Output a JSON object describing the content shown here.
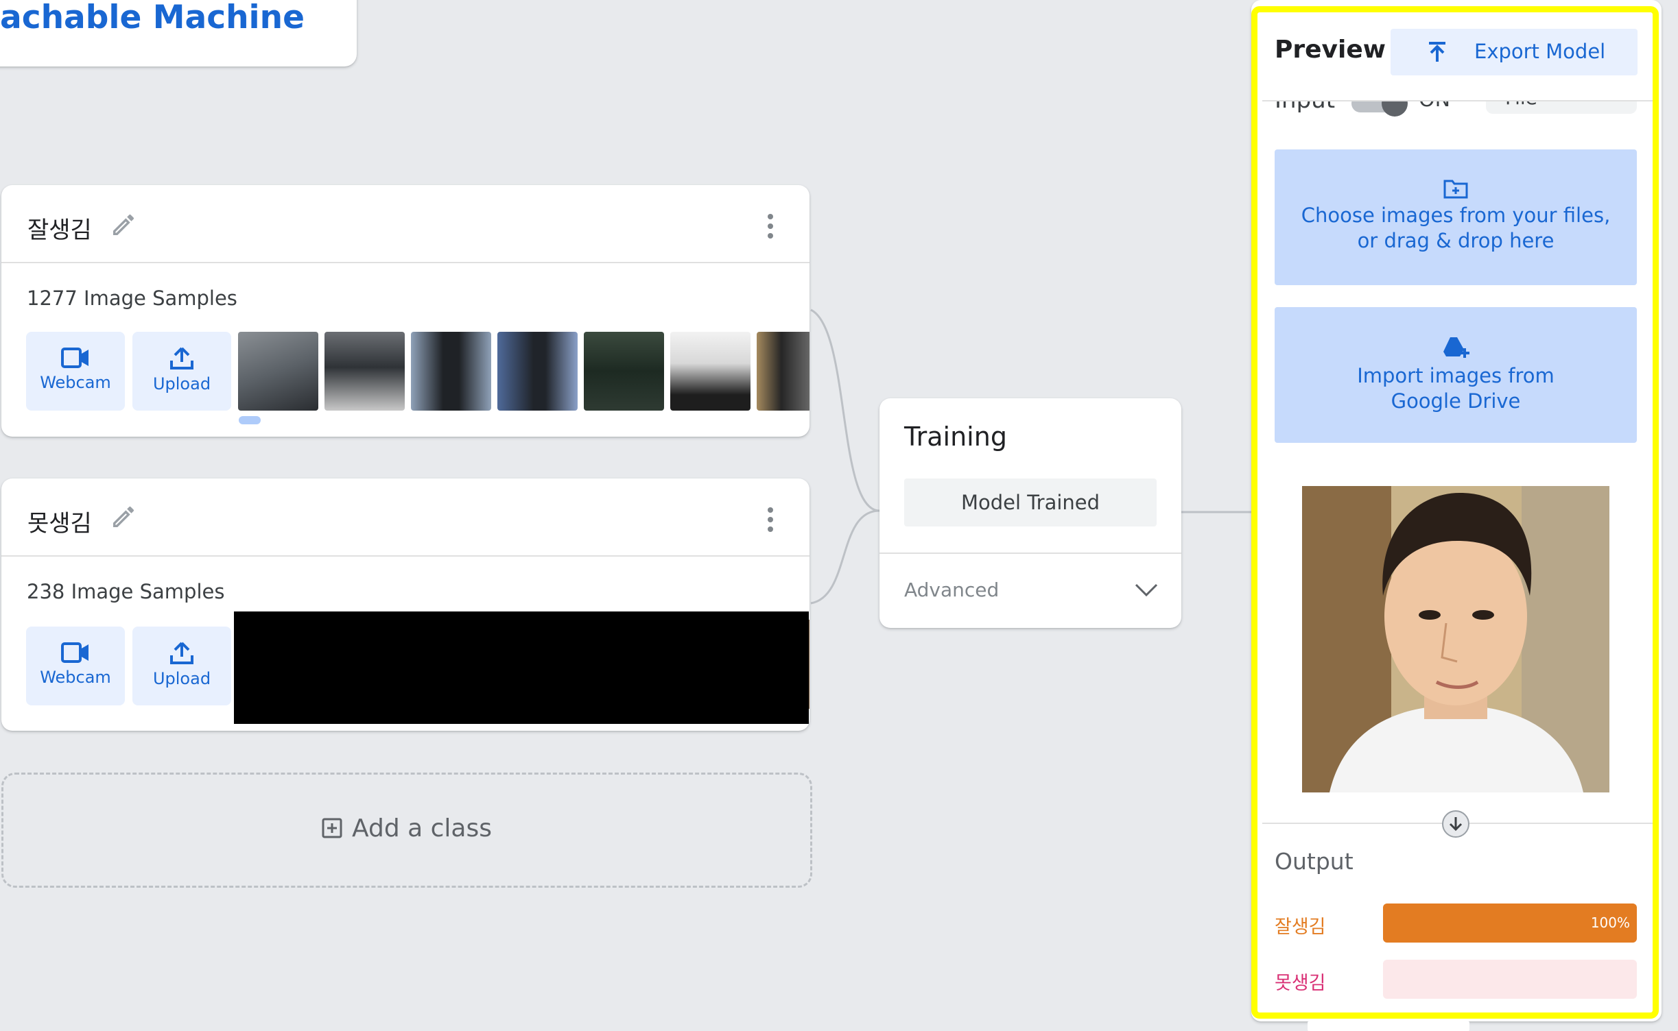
{
  "app": {
    "logo_text": "achable Machine"
  },
  "classes": [
    {
      "name": "잘생김",
      "samples_label": "1277 Image Samples",
      "webcam_label": "Webcam",
      "upload_label": "Upload"
    },
    {
      "name": "못생김",
      "samples_label": "238 Image Samples",
      "webcam_label": "Webcam",
      "upload_label": "Upload"
    }
  ],
  "add_class": {
    "label": "Add a class"
  },
  "training": {
    "title": "Training",
    "button_label": "Model Trained",
    "advanced_label": "Advanced"
  },
  "preview": {
    "title": "Preview",
    "export_label": "Export Model",
    "input_label": "Input",
    "toggle_state": "ON",
    "source_value": "File",
    "choose_files_line1": "Choose images from your files,",
    "choose_files_line2": "or drag & drop here",
    "drive_line1": "Import images from",
    "drive_line2": "Google Drive",
    "output_title": "Output",
    "outputs": [
      {
        "label": "잘생김",
        "value": 1.0,
        "percent_text": "100%",
        "color": "#e37c22",
        "track": "#fce8d5"
      },
      {
        "label": "못생김",
        "value": 0.0,
        "percent_text": "",
        "color": "#d93075",
        "track": "#fce8ea"
      }
    ]
  },
  "colors": {
    "accent": "#1967d2",
    "highlight": "#ffff00",
    "background": "#e8eaed"
  },
  "icons": [
    "edit-icon",
    "more-vert-icon",
    "webcam-icon",
    "upload-icon",
    "add-box-icon",
    "chevron-down-icon",
    "export-icon",
    "folder-add-icon",
    "drive-add-icon",
    "arrow-down-icon"
  ]
}
